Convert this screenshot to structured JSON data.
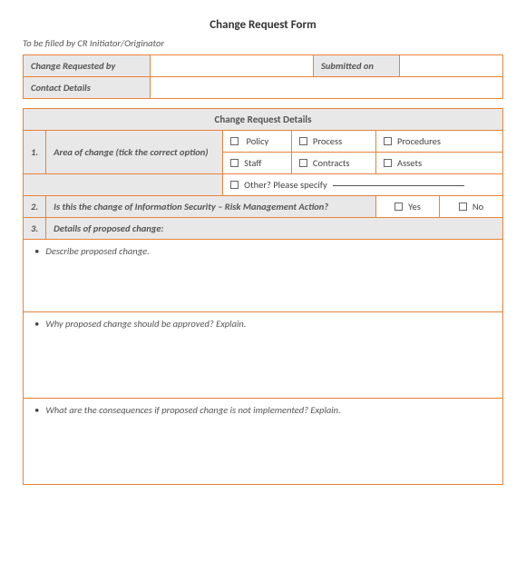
{
  "title": "Change Request Form",
  "subtitle": "To be filled by CR Initiator/Originator",
  "header": {
    "requested_by_label": "Change Requested by",
    "submitted_on_label": "Submitted on",
    "contact_label": "Contact Details"
  },
  "section_title": "Change Request Details",
  "q1": {
    "num": "1.",
    "text": "Area of change (tick  the correct option)",
    "opts": {
      "policy": "Policy",
      "process": "Process",
      "procedures": "Procedures",
      "staff": "Staff",
      "contracts": "Contracts",
      "assets": "Assets",
      "other": "Other? Please specify"
    }
  },
  "q2": {
    "num": "2.",
    "text": "Is this the change of Information Security – Risk Management Action?",
    "yes": "Yes",
    "no": "No"
  },
  "q3": {
    "num": "3.",
    "text": "Details of proposed change:",
    "a": "Describe proposed change.",
    "b": "Why proposed change should be approved? Explain.",
    "c": "What are the consequences if proposed change is not implemented? Explain."
  }
}
